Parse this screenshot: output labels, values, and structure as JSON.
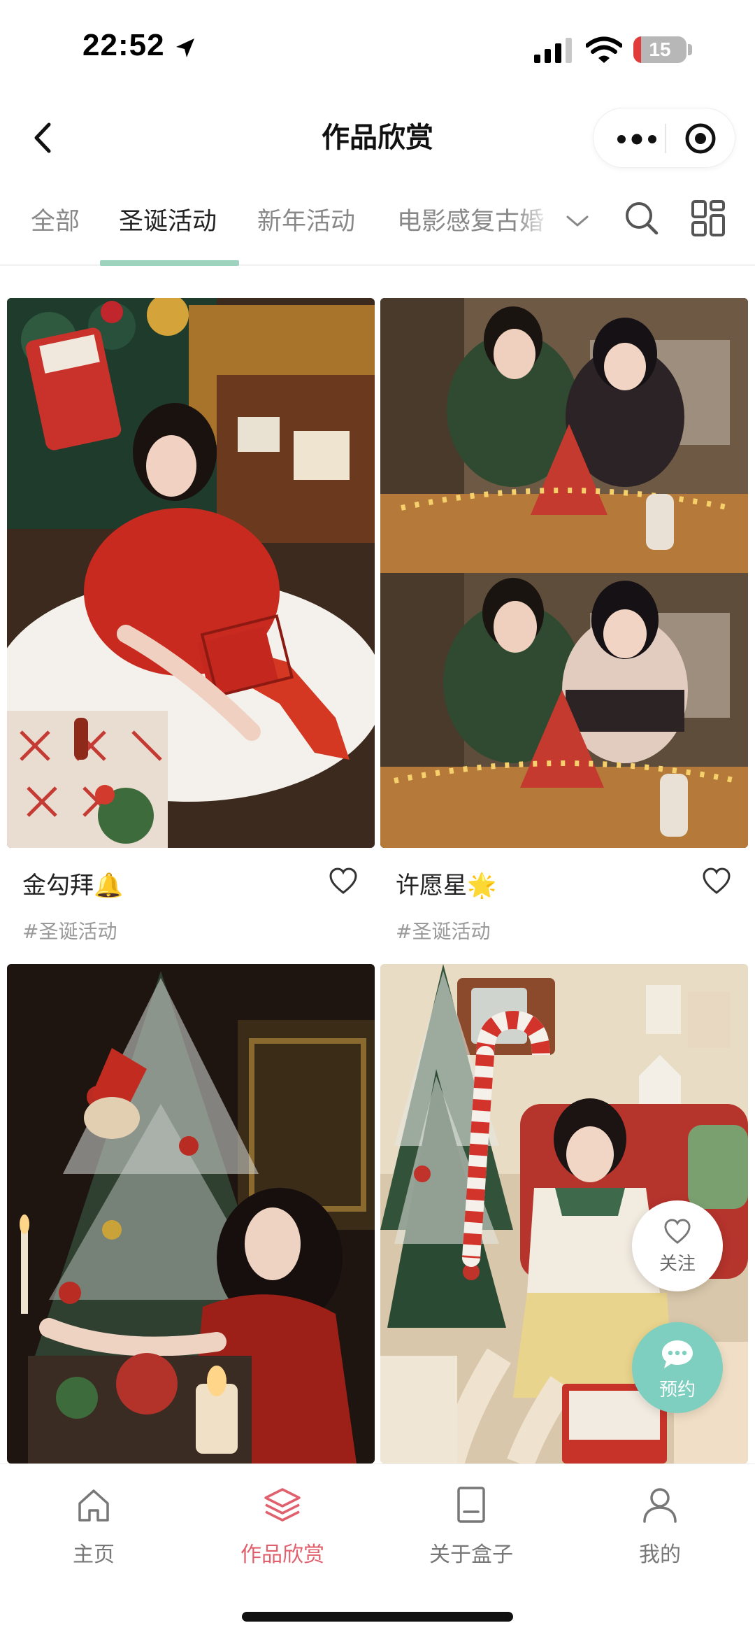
{
  "status_bar": {
    "time": "22:52",
    "battery": "15",
    "battery_level": 0.15
  },
  "header": {
    "title": "作品欣赏"
  },
  "tabs": [
    {
      "label": "全部",
      "active": false
    },
    {
      "label": "圣诞活动",
      "active": true
    },
    {
      "label": "新年活动",
      "active": false
    },
    {
      "label": "电影感复古婚",
      "active": false
    }
  ],
  "cards": [
    {
      "title": "金勾拜🔔",
      "tag": "#圣诞活动",
      "photo_icon": "photo-christmas-girl-red-dress"
    },
    {
      "title": "许愿星🌟",
      "tag": "#圣诞活动",
      "photo_icon": "photo-couple-christmas-cake"
    },
    {
      "title": "",
      "tag": "",
      "photo_icon": "photo-girl-christmas-tree"
    },
    {
      "title": "",
      "tag": "",
      "photo_icon": "photo-girl-candy-cane"
    }
  ],
  "floating": {
    "follow_label": "关注",
    "book_label": "预约"
  },
  "bottom_nav": [
    {
      "label": "主页",
      "icon": "home-icon",
      "active": false
    },
    {
      "label": "作品欣赏",
      "icon": "layers-icon",
      "active": true
    },
    {
      "label": "关于盒子",
      "icon": "document-icon",
      "active": false
    },
    {
      "label": "我的",
      "icon": "user-icon",
      "active": false
    }
  ],
  "colors": {
    "accent": "#9fd1bf",
    "active_nav": "#e0606e",
    "book_button": "#7ecfbf"
  }
}
